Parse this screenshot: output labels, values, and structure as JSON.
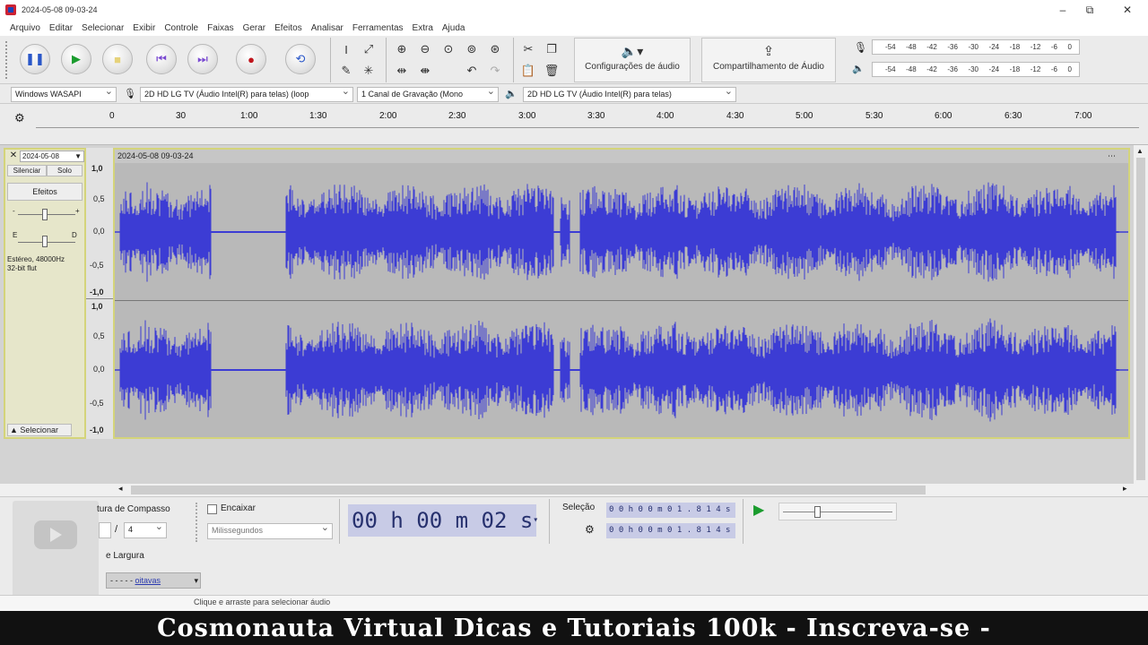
{
  "window": {
    "title": "2024-05-08 09-03-24",
    "minimize": "–",
    "maximize": "⧉",
    "close": "✕"
  },
  "menu": [
    "Arquivo",
    "Editar",
    "Selecionar",
    "Exibir",
    "Controle",
    "Faixas",
    "Gerar",
    "Efeitos",
    "Analisar",
    "Ferramentas",
    "Extra",
    "Ajuda"
  ],
  "toolbar": {
    "audio_settings_label": "Configurações de áudio",
    "share_audio_label": "Compartilhamento de Áudio",
    "meter_ticks": [
      "-54",
      "-48",
      "-42",
      "-36",
      "-30",
      "-24",
      "-18",
      "-12",
      "-6",
      "0"
    ]
  },
  "devices": {
    "host": "Windows WASAPI",
    "input": "2D HD LG TV (Áudio Intel(R) para telas) (loop",
    "channels": "1 Canal de Gravação (Mono",
    "output": "2D HD LG TV (Áudio Intel(R) para telas)"
  },
  "ruler": [
    "0",
    "30",
    "1:00",
    "1:30",
    "2:00",
    "2:30",
    "3:00",
    "3:30",
    "4:00",
    "4:30",
    "5:00",
    "5:30",
    "6:00",
    "6:30",
    "7:00"
  ],
  "track": {
    "name": "2024-05-08",
    "clip_name": "2024-05-08 09-03-24",
    "mute": "Silenciar",
    "solo": "Solo",
    "effects": "Efeitos",
    "info_line1": "Estéreo, 48000Hz",
    "info_line2": "32-bit flut",
    "pan_left": "E",
    "pan_right": "D",
    "select": "Selecionar",
    "scale": [
      "1,0",
      "0,5",
      "0,0",
      "-0,5",
      "-1,0"
    ]
  },
  "bottom": {
    "time_signature_label": "tura de Compasso",
    "time_sig_divider": "/",
    "time_sig_den": "4",
    "snap_label": "Encaixar",
    "snap_unit": "Milissegundos",
    "time_display": "00 h 00 m 02 s",
    "selection_label": "Seleção",
    "selection_start": "0 0 h 0 0 m 0 1 . 8 1 4 s",
    "selection_end": "0 0 h 0 0 m 0 1 . 8 1 4 s",
    "width_label": "e Largura",
    "octave_value": "- - - - -",
    "octave_unit": "oitavas"
  },
  "status": "Clique e arraste para selecionar áudio",
  "banner": "Cosmonauta Virtual Dicas e Tutoriais 100k - Inscreva-se -",
  "colors": {
    "waveform": "#3c3cd4",
    "record": "#c0141c",
    "play": "#1b9c2e",
    "track_border": "#d4d47a"
  }
}
